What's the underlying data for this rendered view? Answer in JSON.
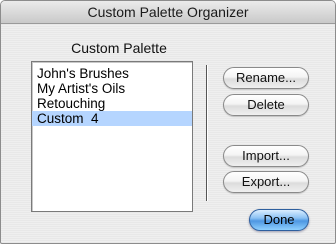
{
  "window": {
    "title": "Custom Palette Organizer"
  },
  "palette": {
    "heading": "Custom Palette",
    "items": [
      {
        "label": "John's Brushes",
        "selected": false
      },
      {
        "label": "My Artist's Oils",
        "selected": false
      },
      {
        "label": "Retouching",
        "selected": false
      },
      {
        "label": "Custom  4",
        "selected": true
      }
    ]
  },
  "buttons": {
    "rename": "Rename...",
    "delete": "Delete",
    "import": "Import...",
    "export": "Export...",
    "done": "Done"
  },
  "colors": {
    "selection": "#b5d5ff",
    "default_button": "#5aa0e6"
  }
}
